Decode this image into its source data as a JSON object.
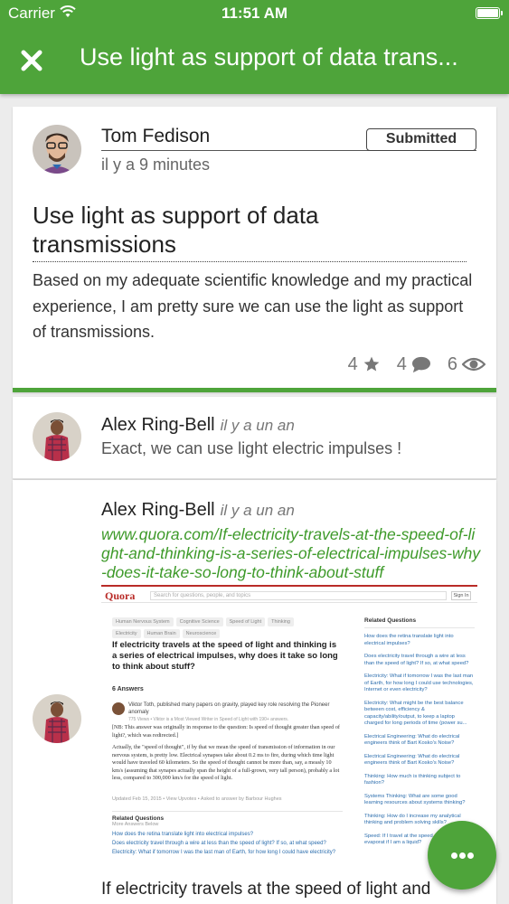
{
  "status_bar": {
    "carrier": "Carrier",
    "time": "11:51 AM"
  },
  "header": {
    "title": "Use light as support of data trans..."
  },
  "post": {
    "author": "Tom Fedison",
    "time": "il y a 9 minutes",
    "badge": "Submitted",
    "title": "Use light as support of data transmissions",
    "body": "Based on my adequate scientific knowledge and my practical experience, I am pretty sure we can use the light as support of transmissions.",
    "stats": {
      "stars": "4",
      "comments": "4",
      "views": "6"
    }
  },
  "comments": [
    {
      "author": "Alex Ring-Bell",
      "time": "il y a un an",
      "text": "Exact, we can use light electric impulses !"
    },
    {
      "author": "Alex Ring-Bell",
      "time": "il y a un an",
      "link": "www.quora.com/If-electricity-travels-at-the-speed-of-light-and-thinking-is-a-series-of-electrical-impulses-why-does-it-take-so-long-to-think-about-stuff",
      "bottom_text": "If electricity travels at the speed of light and thinking is a series of electrical impulses, why does it take so long to think about stuff?"
    }
  ],
  "preview": {
    "logo": "Quora",
    "search_placeholder": "Search for questions, people, and topics",
    "signin": "Sign In",
    "tags": [
      "Human Nervous System",
      "Cognitive Science",
      "Speed of Light",
      "Thinking",
      "Electricity",
      "Human Brain",
      "Neuroscience"
    ],
    "question": "If electricity travels at the speed of light and thinking is a series of electrical impulses, why does it take so long to think about stuff?",
    "answers_count": "6 Answers",
    "answerer": "Viktor Toth, published many papers on gravity, played key role resolving the Pioneer anomaly",
    "answerer_meta": "775 Views • Viktor is a Most Viewed Writer in Speed of Light with 190+ answers.",
    "answer_p1": "[NB: This answer was originally in response to the question: Is speed of thought greater than speed of light?, which was redirected.]",
    "answer_p2": "Actually, the \"speed of thought\", if by that we mean the speed of transmission of information in our nervous system, is pretty low. Electrical synapses take about 0.2 ms to fire, during which time light would have traveled 60 kilometers. So the speed of thought cannot be more than, say, a measly 10 km/s (assuming that synapes actually span the height of a full-grown, very tall person), probably a lot less, compared to 300,000 km/s for the speed of light.",
    "answer_meta": "Updated Feb 15, 2015 • View Upvotes • Asked to answer by Barbour Hughes",
    "related_bottom_title": "Related Questions",
    "related_bottom_sub": "More Answers Below",
    "related_bottom": [
      "How does the retina translate light into electrical impulses?",
      "Does electricity travel through a wire at less than the speed of light? If so, at what speed?",
      "Electricity: What if tomorrow I was the last man of Earth, for how long I could have electricity?"
    ],
    "related_side_title": "Related Questions",
    "related_side": [
      "How does the retina translate light into electrical impulses?",
      "Does electricity travel through a wire at less than the speed of light? If so, at what speed?",
      "Electricity: What if tomorrow I was the last man of Earth, for how long I could use technologies, Internet or even electricity?",
      "Electricity: What might be the best balance between cost, efficiency & capacity/ability/output, to keep a laptop charged for long periods of time (power su...",
      "Electrical Engineering: What do electrical engineers think of Bart Kosko's Noise?",
      "Electrical Engineering: What do electrical engineers think of Bart Kosko's Noise?",
      "Thinking: How much is thinking subject to fashion?",
      "Systems Thinking: What are some good learning resources about systems thinking?",
      "Thinking: How do I increase my analytical thinking and problem solving skills?",
      "Speed: If I travel at the speed of light, will I evaporat if I am a liquid?"
    ]
  },
  "icons": {
    "close": "close-icon",
    "star": "star-icon",
    "comment": "comment-icon",
    "eye": "eye-icon",
    "more": "more-icon"
  },
  "colors": {
    "accent": "#4ea43a",
    "link": "#3e9a2a",
    "quora": "#b92b27"
  }
}
